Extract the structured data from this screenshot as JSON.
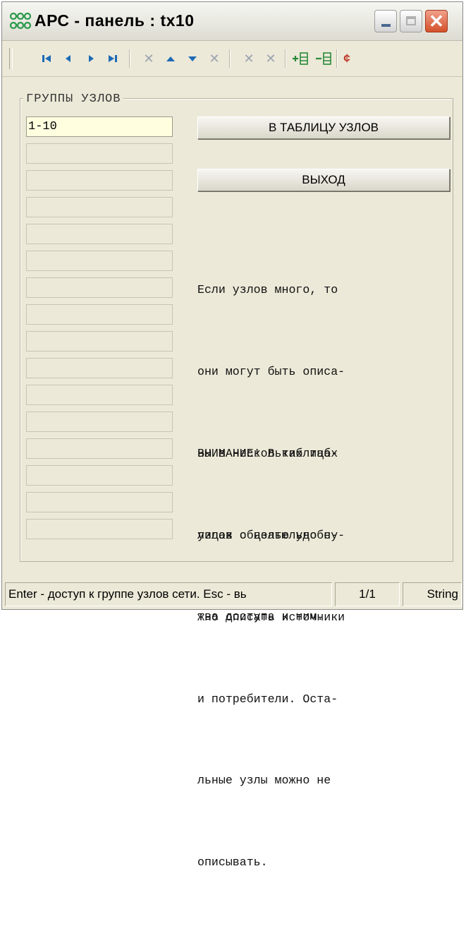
{
  "window": {
    "title": "АРС - панель : tx10",
    "close_glyph": "✕"
  },
  "toolbar": {
    "icons": [
      "first-record-icon",
      "prev-record-icon",
      "next-record-icon",
      "last-record-icon",
      "delete-icon",
      "move-up-icon",
      "move-down-icon",
      "delete-icon",
      "cancel-icon",
      "cancel-icon",
      "add-node-icon",
      "remove-node-icon",
      "refresh-icon"
    ],
    "glyphs": {
      "first": "◂",
      "prev": "◀",
      "next": "▶",
      "last": "▸",
      "x": "✕",
      "up": "▲",
      "down": "▼",
      "add": "+☰",
      "remove": "−☰",
      "refresh": "¢"
    }
  },
  "groups": {
    "legend": "ГРУППЫ УЗЛОВ",
    "items": [
      "1-10",
      "",
      "",
      "",
      "",
      "",
      "",
      "",
      "",
      "",
      "",
      "",
      "",
      "",
      "",
      ""
    ]
  },
  "buttons": {
    "to_table": "В ТАБЛИЦУ УЗЛОВ",
    "exit": "ВЫХОД"
  },
  "info": {
    "para1": [
      "Если узлов много, то",
      "они могут быть описа-",
      "ны в нескольких таб-",
      "лицах с целью удобс-",
      "тва доступа к ним."
    ],
    "para2": [
      "ВНИМАНИЕ! В таблицах",
      "узлов обязательно ну-",
      "жно описать источники",
      "и потребители. Оста-",
      "льные узлы можно не",
      "описывать."
    ]
  },
  "statusbar": {
    "hint": "Enter - доступ к группе узлов сети.  Esc - вь",
    "page": "1/1",
    "type": "String"
  }
}
